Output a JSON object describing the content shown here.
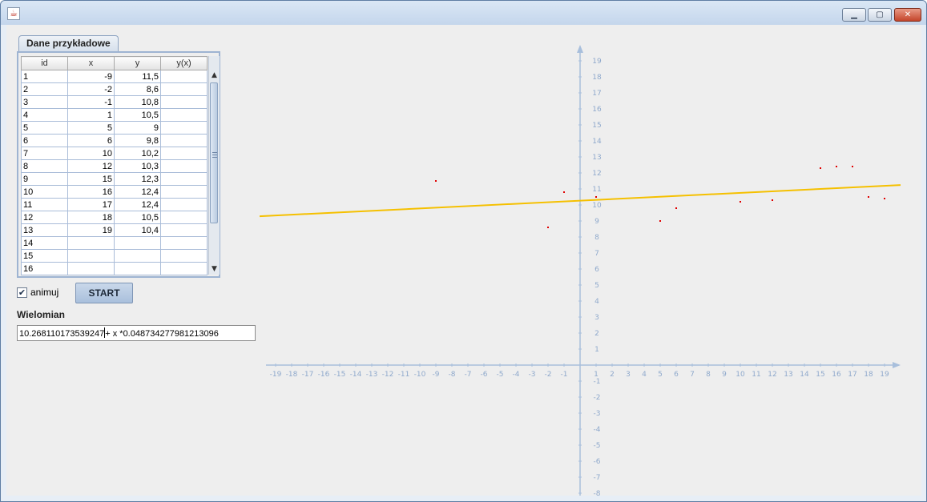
{
  "window": {
    "icon": "java-app-icon",
    "minimize_icon": "minimize-icon",
    "maximize_icon": "maximize-icon",
    "close_icon": "close-icon"
  },
  "tab": {
    "label": "Dane przykładowe"
  },
  "table": {
    "columns": [
      "id",
      "x",
      "y",
      "y(x)"
    ],
    "rows": [
      [
        "1",
        "-9",
        "11,5",
        ""
      ],
      [
        "2",
        "-2",
        "8,6",
        ""
      ],
      [
        "3",
        "-1",
        "10,8",
        ""
      ],
      [
        "4",
        "1",
        "10,5",
        ""
      ],
      [
        "5",
        "5",
        "9",
        ""
      ],
      [
        "6",
        "6",
        "9,8",
        ""
      ],
      [
        "7",
        "10",
        "10,2",
        ""
      ],
      [
        "8",
        "12",
        "10,3",
        ""
      ],
      [
        "9",
        "15",
        "12,3",
        ""
      ],
      [
        "10",
        "16",
        "12,4",
        ""
      ],
      [
        "11",
        "17",
        "12,4",
        ""
      ],
      [
        "12",
        "18",
        "10,5",
        ""
      ],
      [
        "13",
        "19",
        "10,4",
        ""
      ],
      [
        "14",
        "",
        "",
        ""
      ],
      [
        "15",
        "",
        "",
        ""
      ],
      [
        "16",
        "",
        "",
        ""
      ]
    ]
  },
  "controls": {
    "animate_label": "animuj",
    "animate_checked": true,
    "start_label": "START",
    "polynomial_label": "Wielomian",
    "polynomial_value_left": "10.268110173539247",
    "polynomial_value_right": "+ x *0.048734277981213096"
  },
  "chart_data": {
    "type": "scatter",
    "x_range": [
      -20,
      20
    ],
    "y_range": [
      -8,
      19.5
    ],
    "x_ticks": [
      -19,
      -18,
      -17,
      -16,
      -15,
      -14,
      -13,
      -12,
      -11,
      -10,
      -9,
      -8,
      -7,
      -6,
      -5,
      -4,
      -3,
      -2,
      -1,
      1,
      2,
      3,
      4,
      5,
      6,
      7,
      8,
      9,
      10,
      11,
      12,
      13,
      14,
      15,
      16,
      17,
      18,
      19
    ],
    "y_ticks": [
      19,
      18,
      17,
      16,
      15,
      14,
      13,
      12,
      11,
      10,
      9,
      8,
      7,
      6,
      5,
      4,
      3,
      2,
      1,
      -1,
      -2,
      -3,
      -4,
      -5,
      -6,
      -7,
      -8
    ],
    "points": [
      {
        "x": -9,
        "y": 11.5
      },
      {
        "x": -2,
        "y": 8.6
      },
      {
        "x": -1,
        "y": 10.8
      },
      {
        "x": 1,
        "y": 10.5
      },
      {
        "x": 5,
        "y": 9
      },
      {
        "x": 6,
        "y": 9.8
      },
      {
        "x": 10,
        "y": 10.2
      },
      {
        "x": 12,
        "y": 10.3
      },
      {
        "x": 15,
        "y": 12.3
      },
      {
        "x": 16,
        "y": 12.4
      },
      {
        "x": 17,
        "y": 12.4
      },
      {
        "x": 18,
        "y": 10.5
      },
      {
        "x": 19,
        "y": 10.4
      }
    ],
    "fit_line": {
      "intercept": 10.268110173539247,
      "slope": 0.048734277981213096,
      "x_from": -20,
      "x_to": 20
    },
    "colors": {
      "axis": "#a8bfdc",
      "tick_label": "#8fa9cc",
      "points": "#e00000",
      "fit_line": "#f5c000"
    },
    "grid": false
  }
}
